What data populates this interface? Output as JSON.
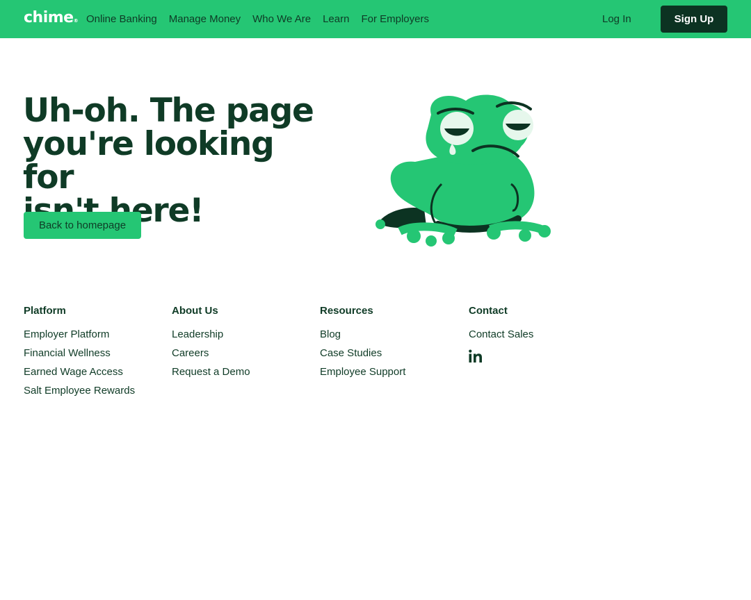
{
  "brand": {
    "logo_text": "chime",
    "logo_mark": "®",
    "colors": {
      "accent": "#25c674",
      "dark": "#0c3322",
      "text": "#0f3b26"
    }
  },
  "nav": {
    "links": [
      "Online Banking",
      "Manage Money",
      "Who We Are",
      "Learn",
      "For Employers"
    ],
    "login": "Log In",
    "signup": "Sign Up"
  },
  "hero": {
    "title_lines": [
      "Uh-oh. The page",
      "you're looking for",
      "isn't here!"
    ],
    "button": "Back to homepage",
    "illustration": "sad-frog-illustration"
  },
  "footer": {
    "columns": [
      {
        "heading": "Platform",
        "links": [
          "Employer Platform",
          "Financial Wellness",
          "Earned Wage Access",
          "Salt Employee Rewards"
        ]
      },
      {
        "heading": "About Us",
        "links": [
          "Leadership",
          "Careers",
          "Request a Demo"
        ]
      },
      {
        "heading": "Resources",
        "links": [
          "Blog",
          "Case Studies",
          "Employee Support"
        ]
      },
      {
        "heading": "Contact",
        "links": [
          "Contact Sales"
        ],
        "social_icon": "linkedin-icon"
      }
    ]
  }
}
